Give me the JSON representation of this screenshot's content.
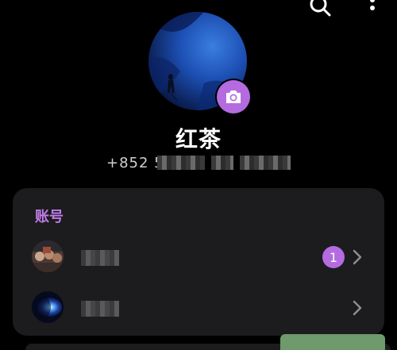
{
  "header": {
    "search_icon": "search-icon",
    "more_icon": "more-vert-icon"
  },
  "profile": {
    "name": "红茶",
    "phone_visible_prefix": "+852 5",
    "camera_icon": "camera-icon"
  },
  "accounts_section": {
    "title": "账号",
    "accounts": [
      {
        "badge": "1",
        "chevron_icon": "chevron-right-icon"
      },
      {
        "badge": null,
        "chevron_icon": "chevron-right-icon"
      }
    ]
  },
  "colors": {
    "accent": "#b56be0",
    "section_title": "#c07be9",
    "card_bg": "#1c1c1e",
    "background": "#000000"
  }
}
